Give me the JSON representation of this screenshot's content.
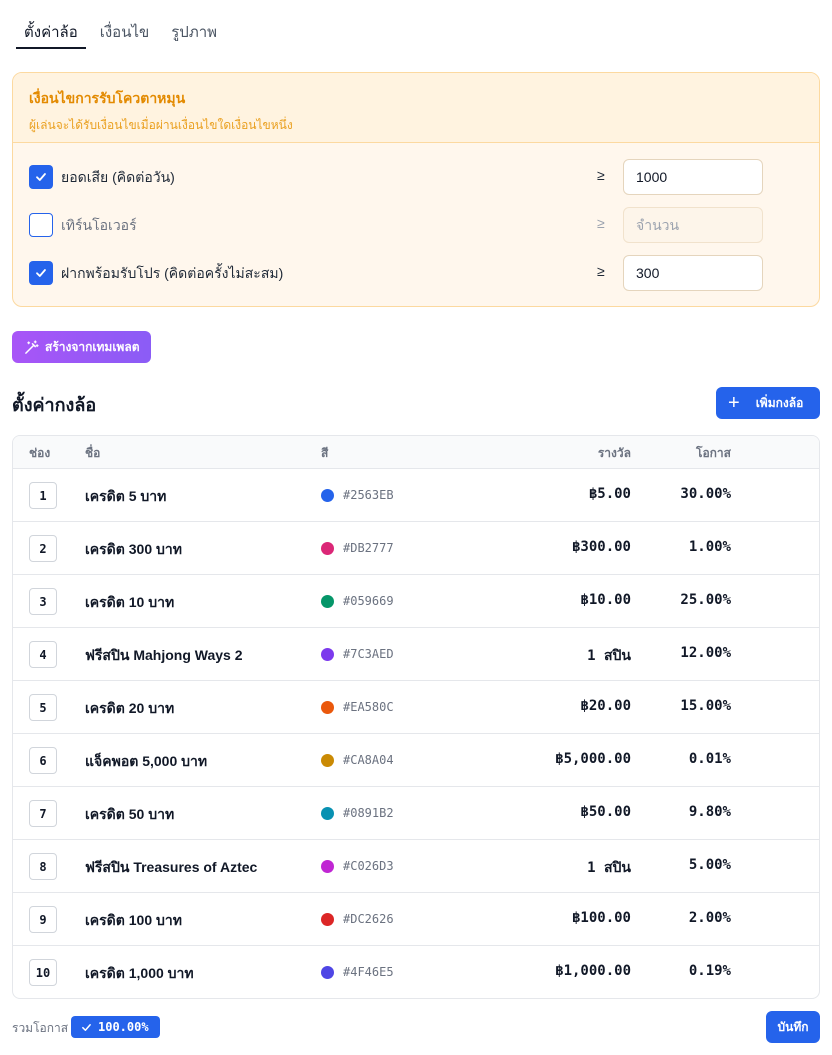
{
  "tabs": [
    {
      "label": "ตั้งค่าล้อ",
      "active": true
    },
    {
      "label": "เงื่อนไข",
      "active": false
    },
    {
      "label": "รูปภาพ",
      "active": false
    }
  ],
  "conditions": {
    "title": "เงื่อนไขการรับโควตาหมุน",
    "subtitle": "ผู้เล่นจะได้รับเงื่อนไขเมื่อผ่านเงื่อนไขใดเงื่อนไขหนึ่ง",
    "operator": "≥",
    "rows": [
      {
        "label": "ยอดเสีย (คิดต่อวัน)",
        "checked": true,
        "value": "1000",
        "placeholder": "จำนวน"
      },
      {
        "label": "เทิร์นโอเวอร์",
        "checked": false,
        "value": "",
        "placeholder": "จำนวน"
      },
      {
        "label": "ฝากพร้อมรับโปร (คิดต่อครั้งไม่สะสม)",
        "checked": true,
        "value": "300",
        "placeholder": "จำนวน"
      }
    ]
  },
  "template_button": {
    "label": "สร้างจากเทมเพลต",
    "icon": "magic-wand-icon"
  },
  "section": {
    "title": "ตั้งค่ากงล้อ",
    "add_label": "เพิ่มกงล้อ"
  },
  "table": {
    "headers": {
      "slot": "ช่อง",
      "name": "ชื่อ",
      "color": "สี",
      "reward": "รางวัล",
      "chance": "โอกาส"
    },
    "rows": [
      {
        "slot": "1",
        "name": "เครดิต 5 บาท",
        "color": "#2563EB",
        "reward": "฿5.00",
        "chance": "30.00%"
      },
      {
        "slot": "2",
        "name": "เครดิต 300 บาท",
        "color": "#DB2777",
        "reward": "฿300.00",
        "chance": "1.00%"
      },
      {
        "slot": "3",
        "name": "เครดิต 10 บาท",
        "color": "#059669",
        "reward": "฿10.00",
        "chance": "25.00%"
      },
      {
        "slot": "4",
        "name": "ฟรีสปิน Mahjong Ways 2",
        "color": "#7C3AED",
        "reward": "1 สปิน",
        "chance": "12.00%"
      },
      {
        "slot": "5",
        "name": "เครดิต 20 บาท",
        "color": "#EA580C",
        "reward": "฿20.00",
        "chance": "15.00%"
      },
      {
        "slot": "6",
        "name": "แจ็คพอต 5,000 บาท",
        "color": "#CA8A04",
        "reward": "฿5,000.00",
        "chance": "0.01%"
      },
      {
        "slot": "7",
        "name": "เครดิต 50 บาท",
        "color": "#0891B2",
        "reward": "฿50.00",
        "chance": "9.80%"
      },
      {
        "slot": "8",
        "name": "ฟรีสปิน Treasures of Aztec",
        "color": "#C026D3",
        "reward": "1 สปิน",
        "chance": "5.00%"
      },
      {
        "slot": "9",
        "name": "เครดิต 100 บาท",
        "color": "#DC2626",
        "reward": "฿100.00",
        "chance": "2.00%"
      },
      {
        "slot": "10",
        "name": "เครดิต 1,000 บาท",
        "color": "#4F46E5",
        "reward": "฿1,000.00",
        "chance": "0.19%"
      }
    ]
  },
  "footer": {
    "total_label": "รวมโอกาส",
    "total_value": "100.00%",
    "save_label": "บันทึก"
  }
}
